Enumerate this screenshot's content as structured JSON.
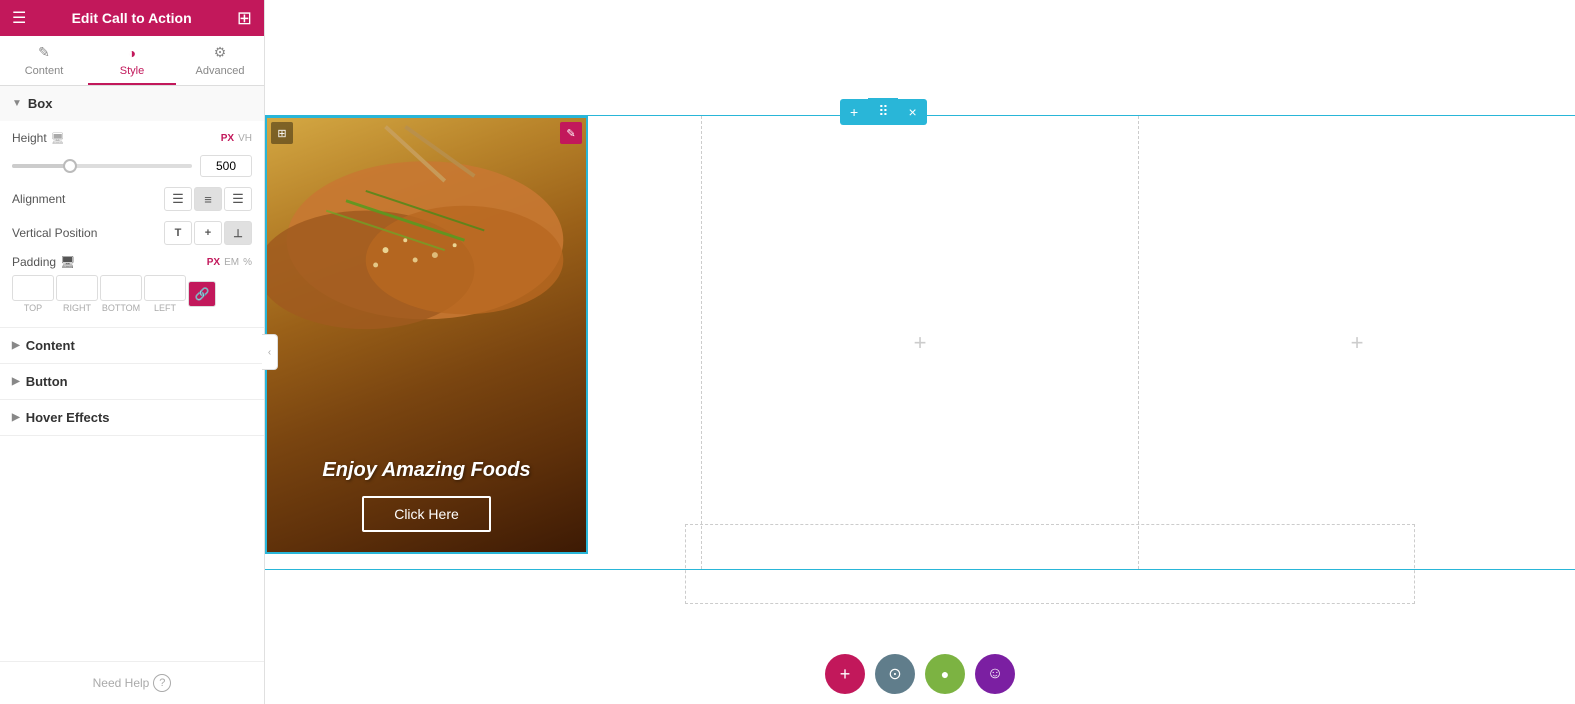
{
  "panel": {
    "title": "Edit Call to Action",
    "tabs": [
      {
        "id": "content",
        "label": "Content",
        "icon": "✏️"
      },
      {
        "id": "style",
        "label": "Style",
        "icon": "⊙"
      },
      {
        "id": "advanced",
        "label": "Advanced",
        "icon": "⚙️"
      }
    ],
    "activeTab": "style"
  },
  "box_section": {
    "label": "Box",
    "expanded": true,
    "height": {
      "label": "Height",
      "value": "500",
      "units": [
        "PX",
        "VH"
      ],
      "activeUnit": "PX",
      "sliderPercent": 32
    },
    "alignment": {
      "label": "Alignment",
      "options": [
        "left",
        "center",
        "right"
      ],
      "active": "center"
    },
    "vertical_position": {
      "label": "Vertical Position",
      "options": [
        "top",
        "middle",
        "bottom"
      ],
      "active": "bottom"
    },
    "padding": {
      "label": "Padding",
      "units": [
        "PX",
        "EM",
        "%"
      ],
      "activeUnit": "PX",
      "top": "",
      "right": "",
      "bottom": "",
      "left": ""
    }
  },
  "sections": [
    {
      "id": "content",
      "label": "Content",
      "expanded": false
    },
    {
      "id": "button",
      "label": "Button",
      "expanded": false
    },
    {
      "id": "hover-effects",
      "label": "Hover Effects",
      "expanded": false
    }
  ],
  "need_help": {
    "label": "Need Help",
    "icon": "?"
  },
  "toolbar": {
    "add_label": "+",
    "move_label": "⠿",
    "close_label": "×"
  },
  "canvas": {
    "columns": [
      "+",
      "+",
      "+"
    ],
    "food_card": {
      "title": "Enjoy Amazing Foods",
      "button_label": "Click Here"
    }
  },
  "fabs": [
    {
      "icon": "+",
      "color": "#c2185b",
      "name": "add-fab"
    },
    {
      "icon": "⊙",
      "color": "#607d8b",
      "name": "layers-fab"
    },
    {
      "icon": "●",
      "color": "#7cb342",
      "name": "settings-fab"
    },
    {
      "icon": "☺",
      "color": "#7b1fa2",
      "name": "help-fab"
    }
  ]
}
